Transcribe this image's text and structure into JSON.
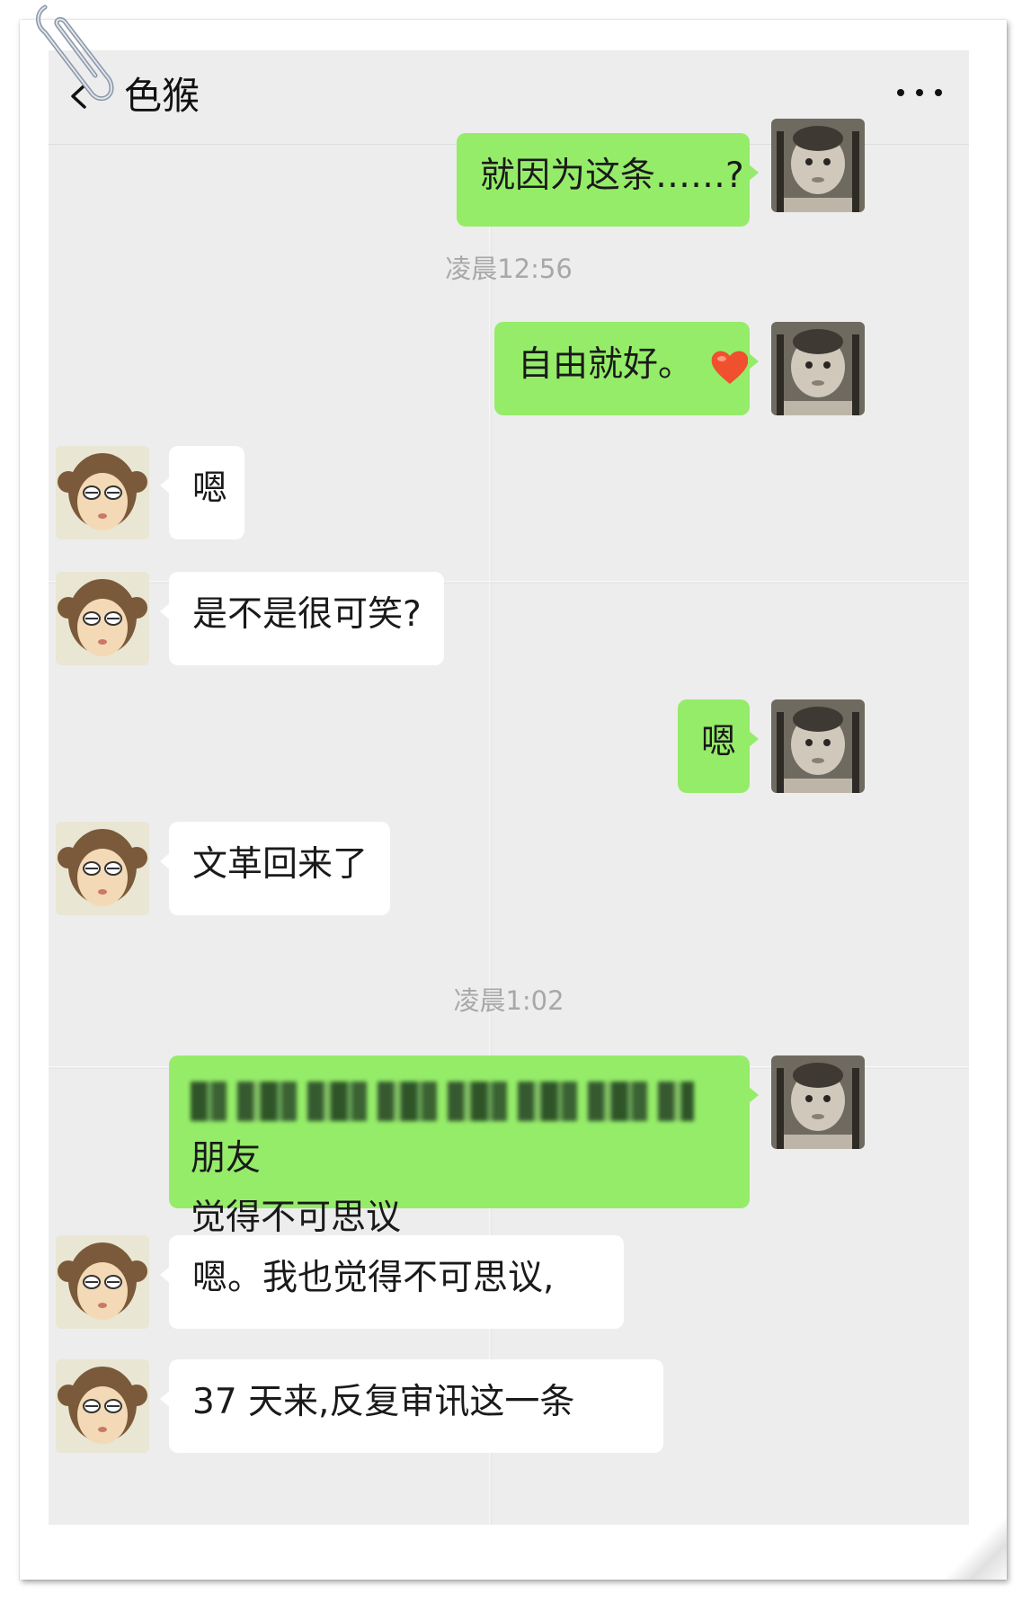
{
  "header": {
    "contact_name": "色猴",
    "back_icon": "chevron-left-icon",
    "more_icon": "more-dots-icon"
  },
  "messages": [
    {
      "type": "message",
      "side": "out",
      "text": "就因为这条……?"
    },
    {
      "type": "timestamp",
      "text": "凌晨12:56"
    },
    {
      "type": "message",
      "side": "out",
      "text": "自由就好。",
      "emoji": "heart"
    },
    {
      "type": "message",
      "side": "in",
      "text": "嗯"
    },
    {
      "type": "message",
      "side": "in",
      "text": "是不是很可笑?"
    },
    {
      "type": "message",
      "side": "out",
      "text": "嗯"
    },
    {
      "type": "message",
      "side": "in",
      "text": "文革回来了"
    },
    {
      "type": "timestamp",
      "text": "凌晨1:02"
    },
    {
      "type": "message",
      "side": "out",
      "line1_suffix": "朋友",
      "line2": "觉得不可思议",
      "redacted": true
    },
    {
      "type": "message",
      "side": "in",
      "text": "嗯。我也觉得不可思议,"
    },
    {
      "type": "message",
      "side": "in",
      "text": "37 天来,反复审讯这一条"
    }
  ],
  "colors": {
    "out_bubble": "#95ec69",
    "in_bubble": "#ffffff",
    "chat_background": "#ededed",
    "timestamp": "#a8a8a8"
  }
}
